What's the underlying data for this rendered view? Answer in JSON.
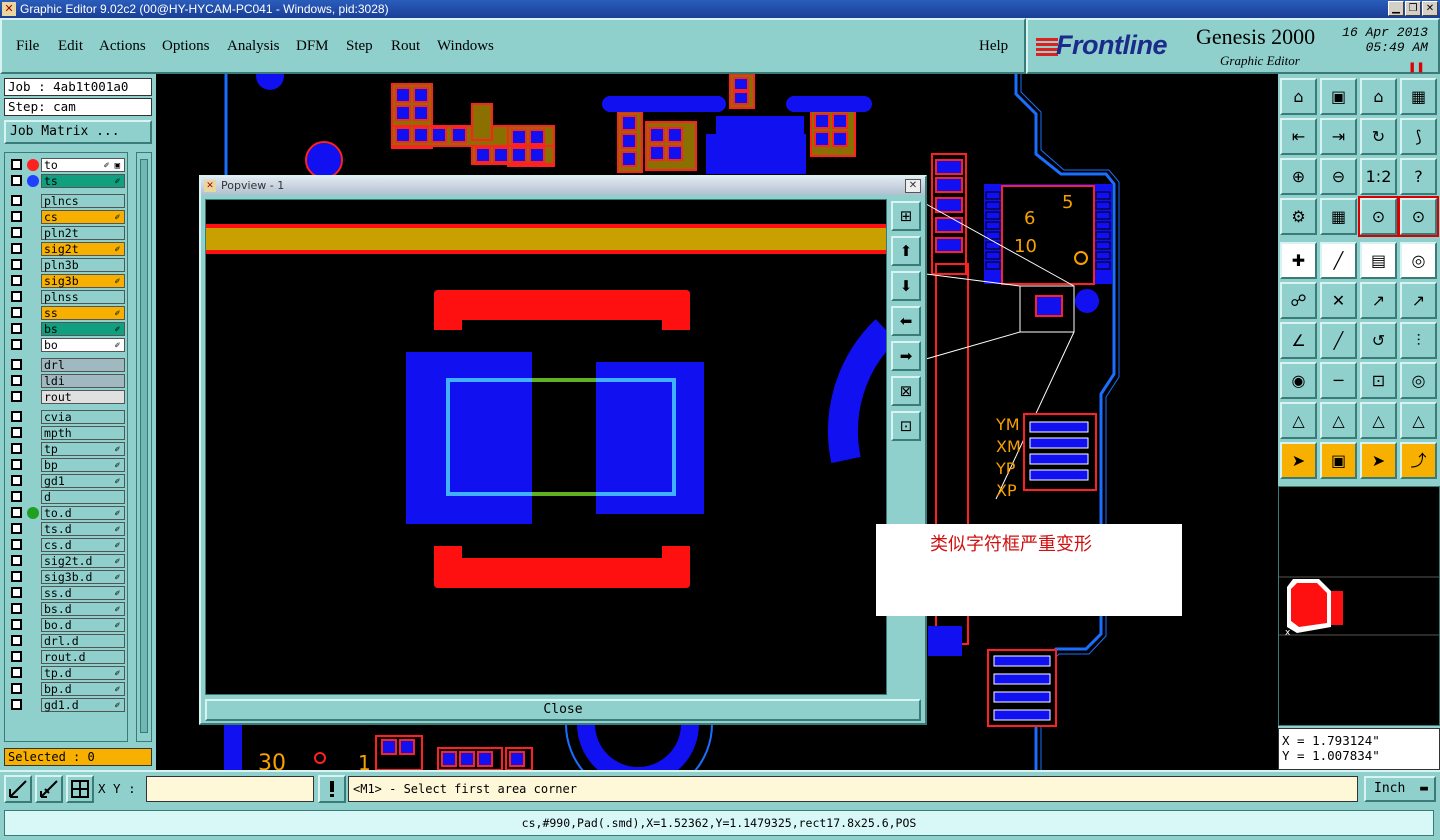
{
  "window": {
    "title": "Graphic Editor 9.02c2 (00@HY-HYCAM-PC041 - Windows, pid:3028)"
  },
  "menu": [
    "File",
    "Edit",
    "Actions",
    "Options",
    "Analysis",
    "DFM",
    "Step",
    "Rout",
    "Windows"
  ],
  "help_label": "Help",
  "logo": {
    "brand": "Frontline",
    "product": "Genesis 2000",
    "subtitle": "Graphic Editor",
    "date": "16 Apr 2013",
    "time": "05:49 AM"
  },
  "job": {
    "job_line": "Job : 4ab1t001a0",
    "step_line": "Step: cam",
    "job_matrix_label": "Job Matrix ..."
  },
  "layers": [
    {
      "name": "to",
      "color": "#ffffff",
      "dot": "#ff2020",
      "flag": "✐ ▣"
    },
    {
      "name": "ts",
      "color": "#10a080",
      "dot": "#2040ff",
      "flag": "✐"
    },
    {
      "name": "plncs",
      "color": "#8fd0cd"
    },
    {
      "name": "cs",
      "color": "#f8b000",
      "flag": "✐"
    },
    {
      "name": "pln2t",
      "color": "#8fd0cd"
    },
    {
      "name": "sig2t",
      "color": "#f8b000",
      "flag": "✐"
    },
    {
      "name": "pln3b",
      "color": "#8fd0cd"
    },
    {
      "name": "sig3b",
      "color": "#f8b000",
      "flag": "✐"
    },
    {
      "name": "plnss",
      "color": "#8fd0cd"
    },
    {
      "name": "ss",
      "color": "#f8b000",
      "flag": "✐"
    },
    {
      "name": "bs",
      "color": "#10a080",
      "flag": "✐"
    },
    {
      "name": "bo",
      "color": "#ffffff",
      "flag": "✐"
    },
    {
      "name": "drl",
      "color": "#a0b8c0"
    },
    {
      "name": "ldi",
      "color": "#a0b8c0"
    },
    {
      "name": "rout",
      "color": "#e0e0e0"
    },
    {
      "name": "cvia",
      "color": "#8fd0cd"
    },
    {
      "name": "mpth",
      "color": "#8fd0cd"
    },
    {
      "name": "tp",
      "color": "#8fd0cd",
      "flag": "✐"
    },
    {
      "name": "bp",
      "color": "#8fd0cd",
      "flag": "✐"
    },
    {
      "name": "gd1",
      "color": "#8fd0cd",
      "flag": "✐"
    },
    {
      "name": "d",
      "color": "#8fd0cd"
    },
    {
      "name": "to.d",
      "color": "#8fd0cd",
      "dot": "#20a020",
      "flag": "✐"
    },
    {
      "name": "ts.d",
      "color": "#8fd0cd",
      "flag": "✐"
    },
    {
      "name": "cs.d",
      "color": "#8fd0cd",
      "flag": "✐"
    },
    {
      "name": "sig2t.d",
      "color": "#8fd0cd",
      "flag": "✐"
    },
    {
      "name": "sig3b.d",
      "color": "#8fd0cd",
      "flag": "✐"
    },
    {
      "name": "ss.d",
      "color": "#8fd0cd",
      "flag": "✐"
    },
    {
      "name": "bs.d",
      "color": "#8fd0cd",
      "flag": "✐"
    },
    {
      "name": "bo.d",
      "color": "#8fd0cd",
      "flag": "✐"
    },
    {
      "name": "drl.d",
      "color": "#8fd0cd"
    },
    {
      "name": "rout.d",
      "color": "#8fd0cd"
    },
    {
      "name": "tp.d",
      "color": "#8fd0cd",
      "flag": "✐"
    },
    {
      "name": "bp.d",
      "color": "#8fd0cd",
      "flag": "✐"
    },
    {
      "name": "gd1.d",
      "color": "#8fd0cd",
      "flag": "✐"
    }
  ],
  "selected_label": "Selected : 0",
  "popview": {
    "title": "Popview - 1",
    "close_label": "Close"
  },
  "annotation": {
    "text": "类似字符框严重变形"
  },
  "canvas_labels": {
    "ym": "YM",
    "xm": "XM",
    "yp": "YP",
    "xp": "XP",
    "n30": "30",
    "n1": "1",
    "n6": "6",
    "n5": "5",
    "n10": "10"
  },
  "coords": {
    "x": "X = 1.793124\"",
    "y": "Y = 1.007834\""
  },
  "xy_label": "X Y :",
  "xy_input_value": "",
  "message": "<M1> - Select first area corner",
  "unit": "Inch",
  "status": "cs,#990,Pad(.smd),X=1.52362,Y=1.1479325,rect17.8x25.6,POS",
  "colors": {
    "panel": "#8fd0cd",
    "pad_blue": "#1010f0",
    "pad_red": "#ff1010",
    "accent_orange": "#f8b000"
  }
}
